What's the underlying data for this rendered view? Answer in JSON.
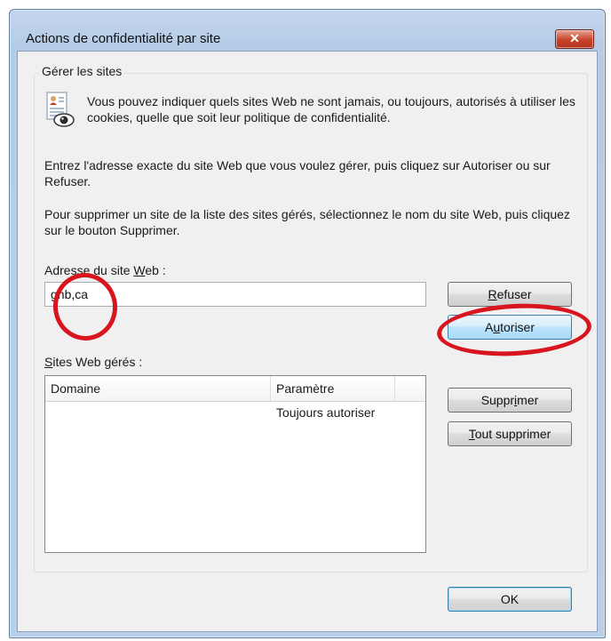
{
  "dialog": {
    "title": "Actions de confidentialité par site",
    "close_glyph": "✕"
  },
  "group": {
    "title": "Gérer les sites",
    "icon": "privacy-document-eye-icon",
    "intro_text": "Vous pouvez indiquer quels sites Web ne sont jamais, ou toujours, autorisés à utiliser les cookies, quelle que soit leur politique de confidentialité.",
    "instructions_add": "Entrez l'adresse exacte du site Web que vous voulez gérer, puis cliquez sur Autoriser ou sur Refuser.",
    "instructions_remove": "Pour supprimer un site de la liste des sites gérés, sélectionnez le nom du site Web, puis cliquez sur le bouton Supprimer."
  },
  "address": {
    "label_before": "Adresse du site ",
    "label_accel": "W",
    "label_after": "eb :",
    "value": "gnb,ca"
  },
  "buttons": {
    "refuse": {
      "accel": "R",
      "rest": "efuser"
    },
    "allow": {
      "before": "A",
      "accel": "u",
      "rest": "toriser"
    },
    "delete": {
      "before": "Suppr",
      "accel": "i",
      "rest": "mer"
    },
    "delete_all": {
      "accel": "T",
      "rest": "out supprimer"
    },
    "ok": "OK"
  },
  "managed_sites": {
    "label_accel": "S",
    "label_rest": "ites Web gérés :",
    "columns": [
      "Domaine",
      "Paramètre"
    ],
    "rows": [
      {
        "domain": "",
        "setting": "Toujours autoriser"
      }
    ]
  },
  "annotations": {
    "color": "#d8141f"
  }
}
